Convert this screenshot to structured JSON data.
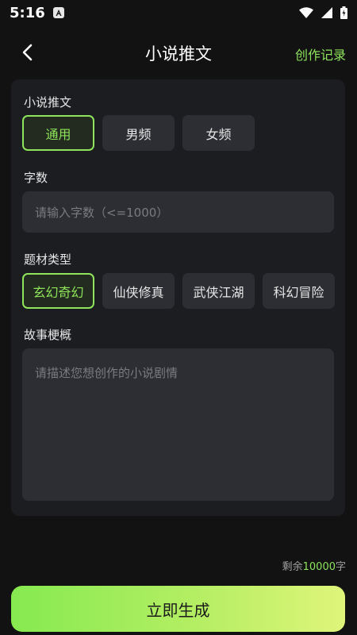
{
  "status_bar": {
    "time": "5:16",
    "notification_icon": "text-a-icon",
    "icons": [
      "wifi-icon",
      "signal-icon",
      "battery-icon"
    ]
  },
  "header": {
    "back_icon": "back-arrow-icon",
    "title": "小说推文",
    "records_link": "创作记录"
  },
  "form": {
    "category": {
      "label": "小说推文",
      "options": [
        "通用",
        "男频",
        "女频"
      ],
      "selected": "通用"
    },
    "word_count": {
      "label": "字数",
      "placeholder": "请输入字数（<=1000）"
    },
    "genre": {
      "label": "题材类型",
      "options": [
        "玄幻奇幻",
        "仙侠修真",
        "武侠江湖",
        "科幻冒险"
      ],
      "selected": "玄幻奇幻"
    },
    "synopsis": {
      "label": "故事梗概",
      "placeholder": "请描述您想创作的小说剧情"
    }
  },
  "remaining": {
    "prefix": "剩余",
    "count": "10000",
    "suffix": "字"
  },
  "generate_button": "立即生成",
  "colors": {
    "accent": "#8ee45a",
    "background": "#121212",
    "card": "#1c1d21",
    "field": "#2c2e33"
  }
}
